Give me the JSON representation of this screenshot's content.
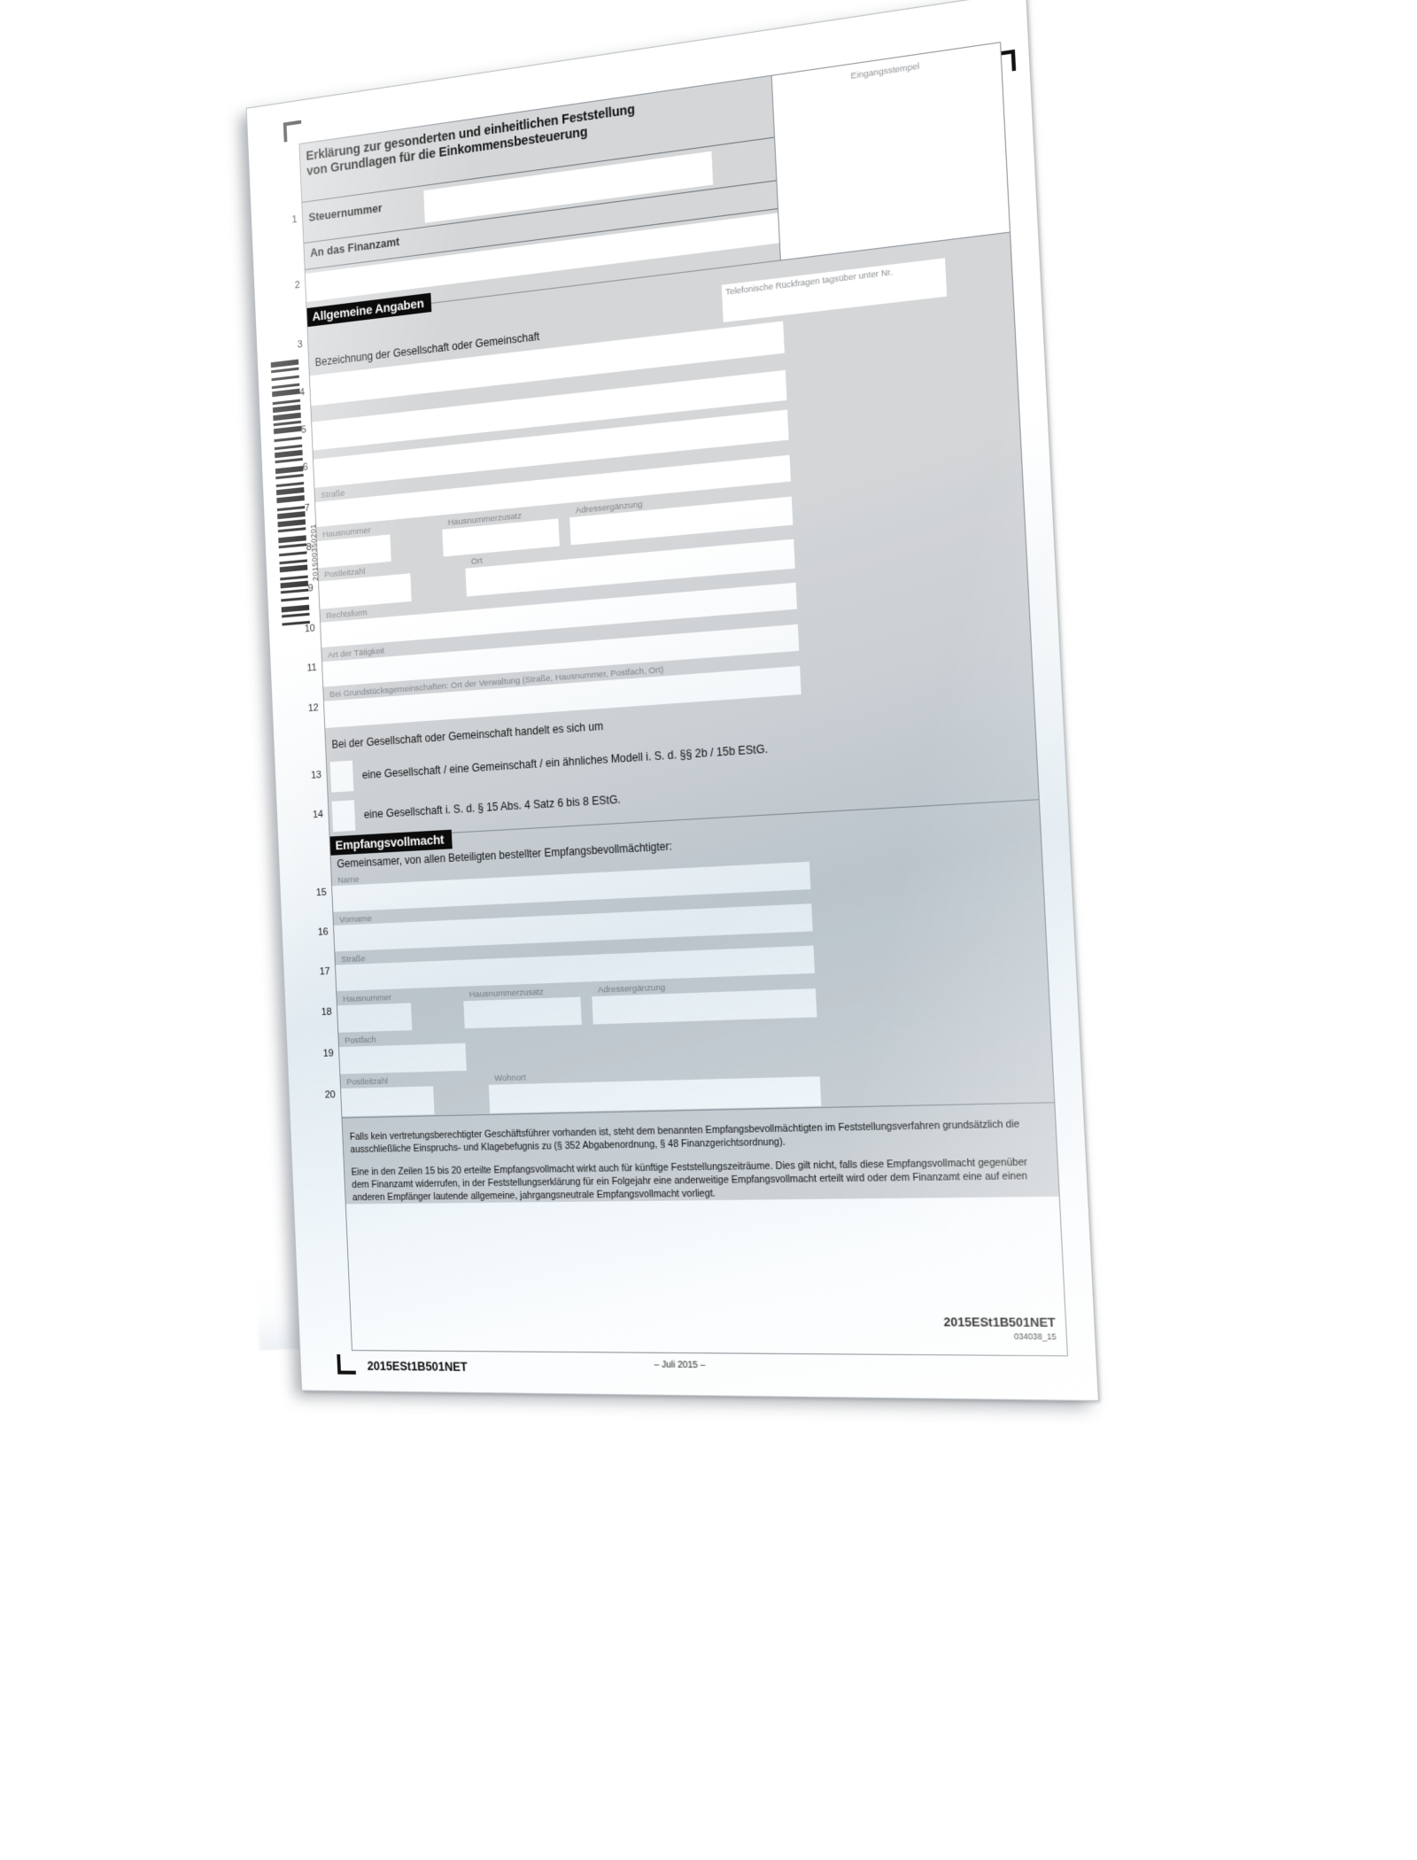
{
  "document": {
    "year": "2015",
    "title_line_1": "Erklärung zur gesonderten und einheitlichen Feststellung",
    "title_line_2": "von Grundlagen für die Einkommensbesteuerung",
    "stamp_box_label": "Eingangsstempel",
    "barcode_number": "201500350201"
  },
  "steuernummer": {
    "line_no": "1",
    "label": "Steuernummer",
    "value": ""
  },
  "finanzamt": {
    "line_no": "2",
    "label": "An das Finanzamt",
    "value": ""
  },
  "section_allgemeine": {
    "heading": "Allgemeine Angaben",
    "line_no": "3",
    "phone_label": "Telefonische Rückfragen tagsüber unter Nr.",
    "phone_value": "",
    "bezeichnung_label": "Bezeichnung der Gesellschaft oder Gemeinschaft",
    "rows": [
      {
        "line_no": "4",
        "value": ""
      },
      {
        "line_no": "5",
        "value": ""
      },
      {
        "line_no": "6",
        "value": ""
      }
    ],
    "strasse": {
      "line_no": "7",
      "label": "Straße",
      "value": ""
    },
    "hausnummer_row": {
      "line_no": "8",
      "fields": [
        {
          "label": "Hausnummer",
          "value": ""
        },
        {
          "label": "Hausnummerzusatz",
          "value": ""
        },
        {
          "label": "Adressergänzung",
          "value": ""
        }
      ]
    },
    "plz_row": {
      "line_no": "9",
      "fields": [
        {
          "label": "Postleitzahl",
          "value": ""
        },
        {
          "label": "Ort",
          "value": ""
        }
      ]
    },
    "rechtsform": {
      "line_no": "10",
      "label": "Rechtsform",
      "value": ""
    },
    "art_der_taetigkeit": {
      "line_no": "11",
      "label": "Art der Tätigkeit",
      "value": ""
    },
    "grundstuecksgemeinschaften": {
      "line_no": "12",
      "label": "Bei Grundstücksgemeinschaften: Ort der Verwaltung (Straße, Hausnummer, Postfach, Ort)",
      "value": ""
    },
    "handelt_es_sich_um": "Bei der Gesellschaft oder Gemeinschaft handelt es sich um",
    "checkboxes": [
      {
        "line_no": "13",
        "label": "eine Gesellschaft / eine Gemeinschaft / ein ähnliches Modell i. S. d. §§ 2b / 15b EStG.",
        "checked": false
      },
      {
        "line_no": "14",
        "label": "eine Gesellschaft i. S. d. § 15 Abs. 4 Satz 6 bis 8 EStG.",
        "checked": false
      }
    ]
  },
  "section_empfangsvollmacht": {
    "heading": "Empfangsvollmacht",
    "subtitle": "Gemeinsamer, von allen Beteiligten bestellter Empfangsbevollmächtigter:",
    "name": {
      "line_no": "15",
      "label": "Name",
      "value": ""
    },
    "vorname": {
      "line_no": "16",
      "label": "Vorname",
      "value": ""
    },
    "strasse": {
      "line_no": "17",
      "label": "Straße",
      "value": ""
    },
    "hausnummer_row": {
      "line_no": "18",
      "fields": [
        {
          "label": "Hausnummer",
          "value": ""
        },
        {
          "label": "Hausnummerzusatz",
          "value": ""
        },
        {
          "label": "Adressergänzung",
          "value": ""
        }
      ]
    },
    "postfach": {
      "line_no": "19",
      "label": "Postfach",
      "value": ""
    },
    "plz_row": {
      "line_no": "20",
      "fields": [
        {
          "label": "Postleitzahl",
          "value": ""
        },
        {
          "label": "Wohnort",
          "value": ""
        }
      ]
    },
    "legal_paragraph_1": "Falls kein vertretungsberechtigter Geschäftsführer vorhanden ist, steht dem benannten Empfangsbevollmächtigten im Feststellungsverfahren grundsätzlich die ausschließliche Einspruchs- und Klagebefugnis zu (§ 352 Abgabenordnung, § 48 Finanzgerichtsordnung).",
    "legal_paragraph_2": "Eine in den Zeilen 15 bis 20 erteilte Empfangsvollmacht wirkt auch für künftige Feststellungszeiträume. Dies gilt nicht, falls diese Empfangsvollmacht gegenüber dem Finanzamt widerrufen, in der Feststellungserklärung für ein Folgejahr eine anderweitige Empfangsvollmacht erteilt wird oder dem Finanzamt eine auf einen anderen Empfänger lautende allgemeine, jahrgangsneutrale Empfangsvollmacht vorliegt."
  },
  "footer": {
    "form_code_left": "2015ESt1B501NET",
    "edition": "– Juli 2015 –",
    "form_code_right": "2015ESt1B501NET",
    "internal_code": "034038_15"
  }
}
